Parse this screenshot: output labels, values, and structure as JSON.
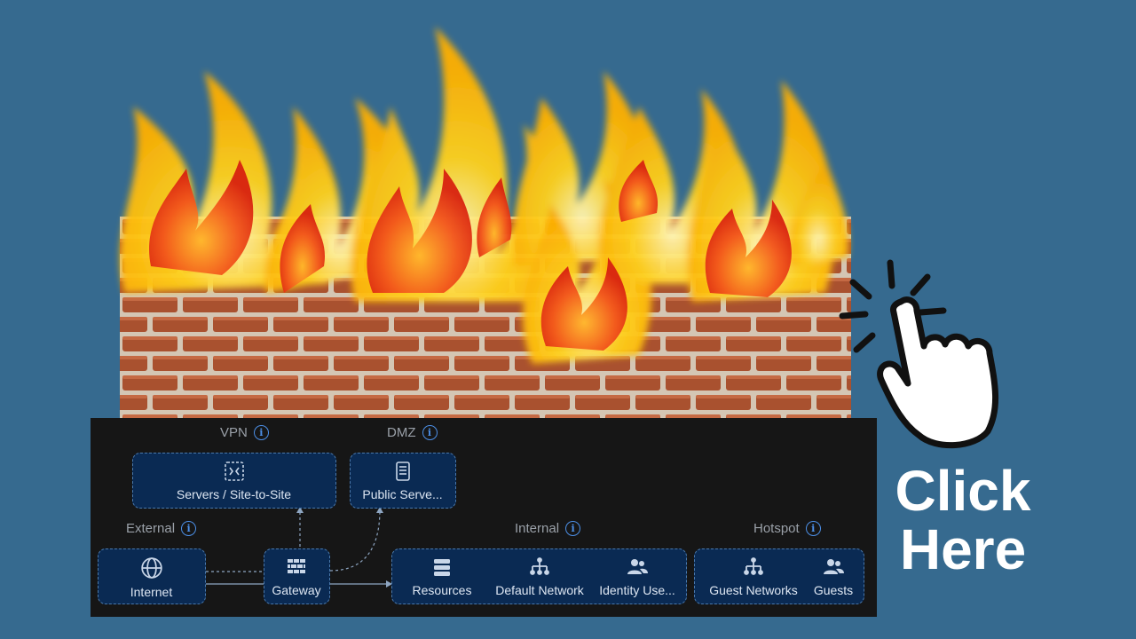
{
  "cta": {
    "line1": "Click",
    "line2": "Here"
  },
  "zones": {
    "vpn": {
      "label": "VPN",
      "nodes": [
        {
          "label": "Servers / Site-to-Site"
        }
      ]
    },
    "dmz": {
      "label": "DMZ",
      "nodes": [
        {
          "label": "Public Serve..."
        }
      ]
    },
    "external": {
      "label": "External",
      "nodes": [
        {
          "label": "Internet"
        }
      ]
    },
    "gateway": {
      "label": "Gateway"
    },
    "internal": {
      "label": "Internal",
      "nodes": [
        {
          "label": "Resources"
        },
        {
          "label": "Default Network"
        },
        {
          "label": "Identity Use..."
        }
      ]
    },
    "hotspot": {
      "label": "Hotspot",
      "nodes": [
        {
          "label": "Guest Networks"
        },
        {
          "label": "Guests"
        }
      ]
    }
  },
  "info_glyph": "i",
  "colors": {
    "background": "#366a8f",
    "panel": "#161616",
    "zone_fill": "#0a2a53",
    "zone_border": "#4a79ad",
    "info": "#4c8fe6",
    "brick": "#a54a2b"
  }
}
